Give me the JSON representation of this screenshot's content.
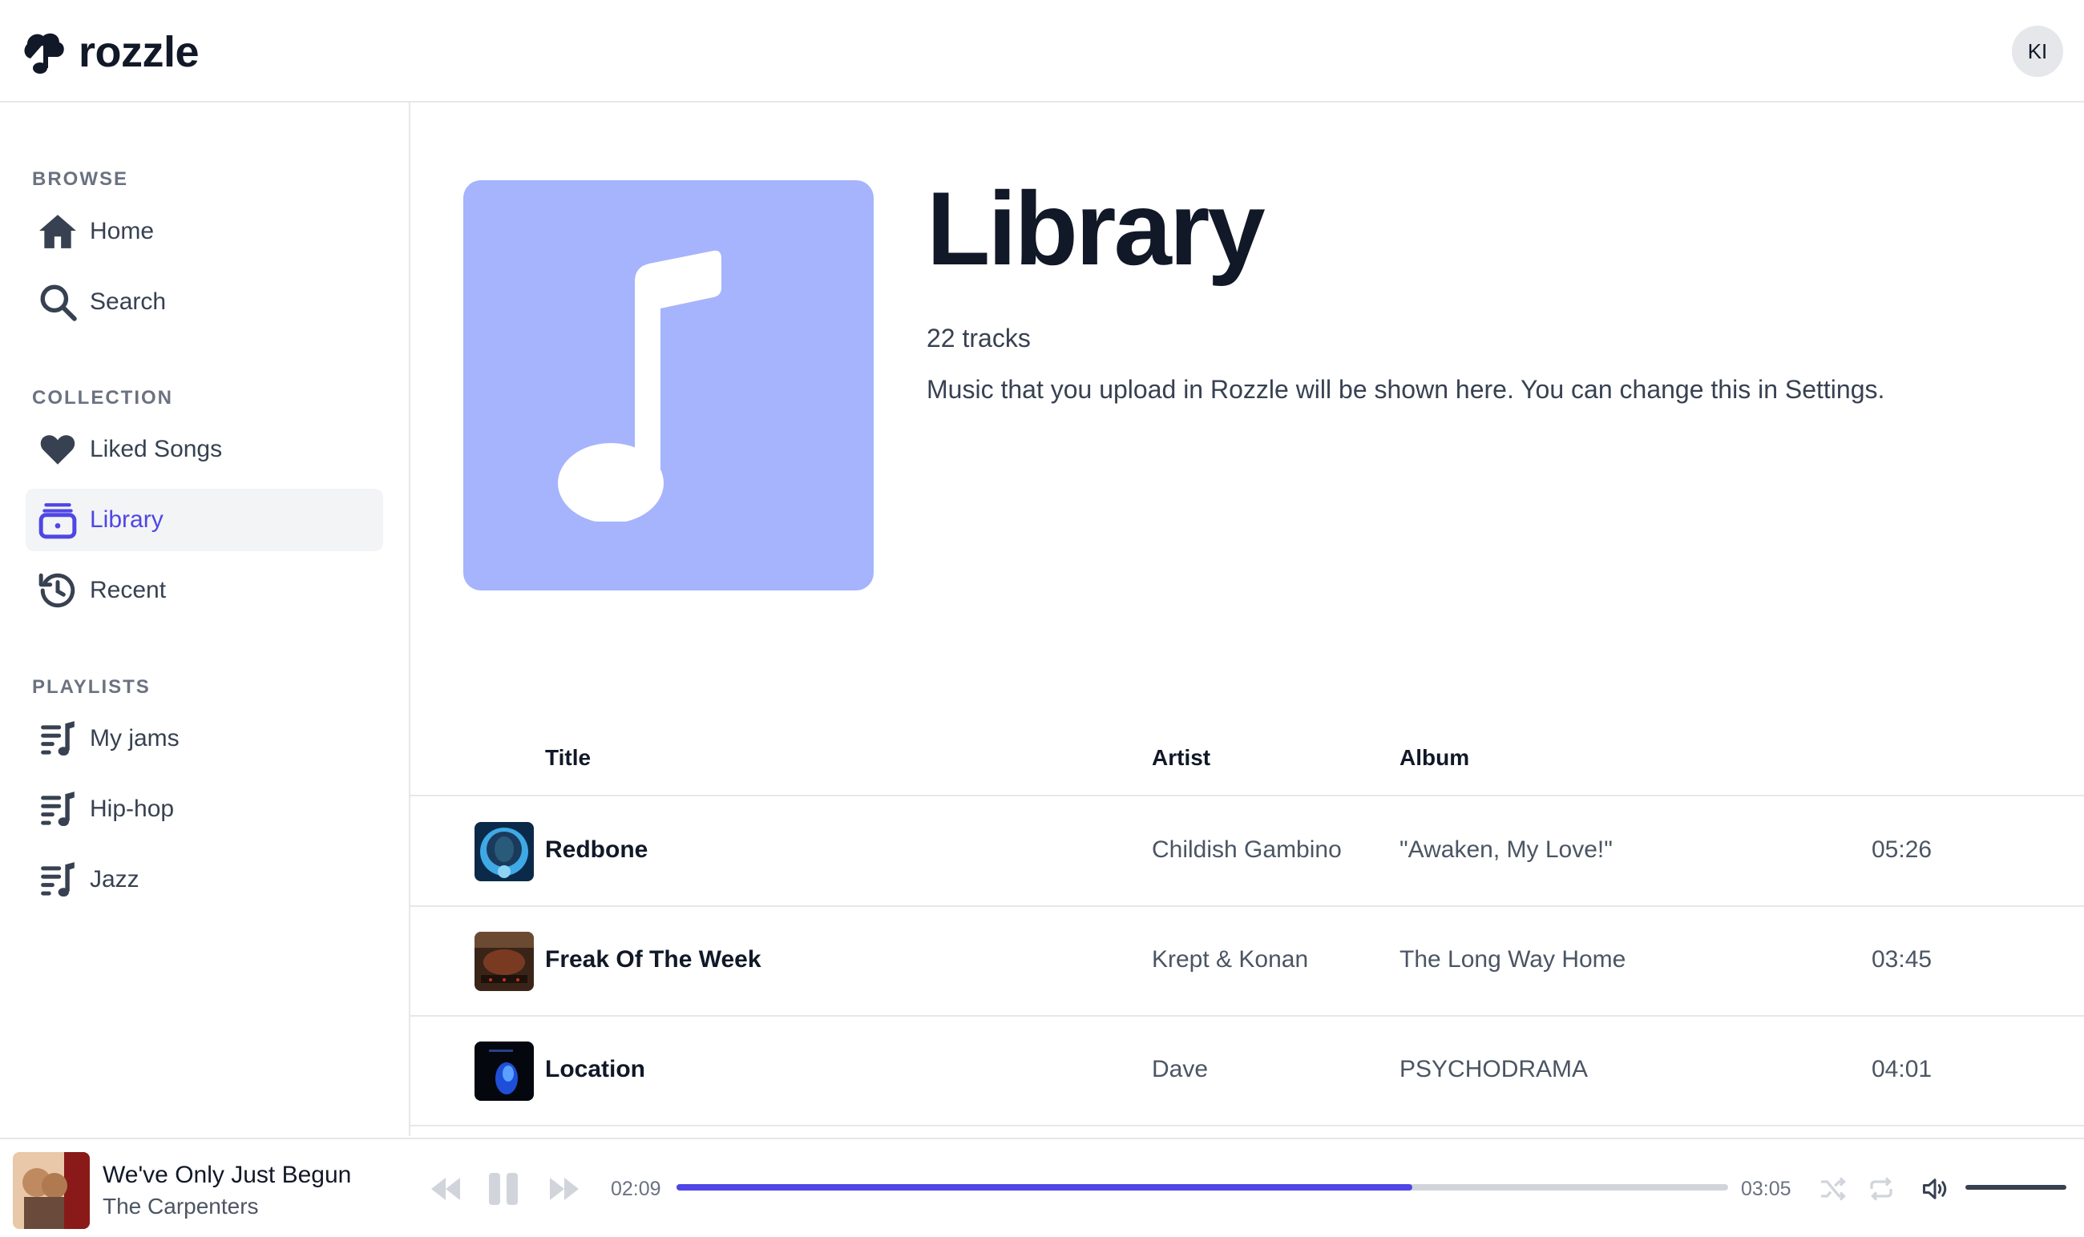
{
  "app": {
    "name": "rozzle"
  },
  "user": {
    "initials": "KI"
  },
  "sidebar": {
    "browse_label": "BROWSE",
    "browse": [
      {
        "label": "Home",
        "icon": "home-icon"
      },
      {
        "label": "Search",
        "icon": "search-icon"
      }
    ],
    "collection_label": "COLLECTION",
    "collection": [
      {
        "label": "Liked Songs",
        "icon": "heart-icon"
      },
      {
        "label": "Library",
        "icon": "library-icon",
        "active": true
      },
      {
        "label": "Recent",
        "icon": "history-icon"
      }
    ],
    "playlists_label": "PLAYLISTS",
    "playlists": [
      {
        "label": "My jams",
        "icon": "playlist-icon"
      },
      {
        "label": "Hip-hop",
        "icon": "playlist-icon"
      },
      {
        "label": "Jazz",
        "icon": "playlist-icon"
      }
    ]
  },
  "library": {
    "title": "Library",
    "track_count": "22 tracks",
    "description": "Music that you upload in Rozzle will be shown here. You can change this in Settings."
  },
  "table": {
    "headers": {
      "title": "Title",
      "artist": "Artist",
      "album": "Album"
    },
    "rows": [
      {
        "title": "Redbone",
        "artist": "Childish Gambino",
        "album": "\"Awaken, My Love!\"",
        "duration": "05:26"
      },
      {
        "title": "Freak Of The Week",
        "artist": "Krept & Konan",
        "album": "The Long Way Home",
        "duration": "03:45"
      },
      {
        "title": "Location",
        "artist": "Dave",
        "album": "PSYCHODRAMA",
        "duration": "04:01"
      }
    ]
  },
  "player": {
    "title": "We've Only Just Begun",
    "artist": "The Carpenters",
    "elapsed": "02:09",
    "total": "03:05",
    "progress_fraction": 0.7,
    "volume_fraction": 1.0
  },
  "colors": {
    "accent": "#4f46e5",
    "cover_bg": "#a5b4fc",
    "active_bg": "#f3f4f6"
  }
}
